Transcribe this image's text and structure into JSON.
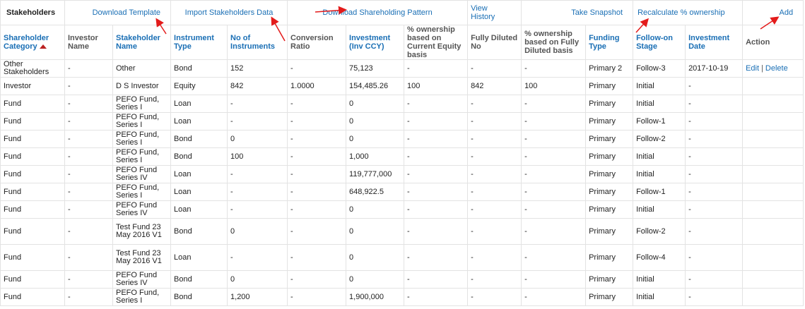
{
  "toolbar": {
    "title": "Stakeholders",
    "download_template": "Download Template",
    "import_data": "Import Stakeholders Data",
    "download_pattern": "Download Shareholding Pattern",
    "view_history": "View History",
    "take_snapshot": "Take Snapshot",
    "recalculate": "Recalculate % ownership",
    "add": "Add"
  },
  "columns": [
    "Shareholder Category",
    "Investor Name",
    "Stakeholder Name",
    "Instrument Type",
    "No of Instruments",
    "Conversion Ratio",
    "Investment (Inv CCY)",
    "% ownership based on Current Equity basis",
    "Fully Diluted No",
    "% ownership based on Fully Diluted basis",
    "Funding Type",
    "Follow-on Stage",
    "Investment Date",
    "Action"
  ],
  "actions": {
    "edit": "Edit",
    "separator": "|",
    "delete": "Delete"
  },
  "rows": [
    [
      "Other Stakeholders",
      "-",
      "Other",
      "Bond",
      "152",
      "-",
      "75,123",
      "-",
      "-",
      "-",
      "Primary 2",
      "Follow-3",
      "2017-10-19"
    ],
    [
      "Investor",
      "-",
      "D S Investor",
      "Equity",
      "842",
      "1.0000",
      "154,485.26",
      "100",
      "842",
      "100",
      "Primary",
      "Initial",
      "-"
    ],
    [
      "Fund",
      "-",
      "PEFO Fund, Series I",
      "Loan",
      "-",
      "-",
      "0",
      "-",
      "-",
      "-",
      "Primary",
      "Initial",
      "-"
    ],
    [
      "Fund",
      "-",
      "PEFO Fund, Series I",
      "Loan",
      "-",
      "-",
      "0",
      "-",
      "-",
      "-",
      "Primary",
      "Follow-1",
      "-"
    ],
    [
      "Fund",
      "-",
      "PEFO Fund, Series I",
      "Bond",
      "0",
      "-",
      "0",
      "-",
      "-",
      "-",
      "Primary",
      "Follow-2",
      "-"
    ],
    [
      "Fund",
      "-",
      "PEFO Fund, Series I",
      "Bond",
      "100",
      "-",
      "1,000",
      "-",
      "-",
      "-",
      "Primary",
      "Initial",
      "-"
    ],
    [
      "Fund",
      "-",
      "PEFO Fund Series IV",
      "Loan",
      "-",
      "-",
      "119,777,000",
      "-",
      "-",
      "-",
      "Primary",
      "Initial",
      "-"
    ],
    [
      "Fund",
      "-",
      "PEFO Fund, Series I",
      "Loan",
      "-",
      "-",
      "648,922.5",
      "-",
      "-",
      "-",
      "Primary",
      "Follow-1",
      "-"
    ],
    [
      "Fund",
      "-",
      "PEFO Fund Series IV",
      "Loan",
      "-",
      "-",
      "0",
      "-",
      "-",
      "-",
      "Primary",
      "Initial",
      "-"
    ],
    [
      "Fund",
      "-",
      "Test Fund 23 May 2016 V1",
      "Bond",
      "0",
      "-",
      "0",
      "-",
      "-",
      "-",
      "Primary",
      "Follow-2",
      "-"
    ],
    [
      "Fund",
      "-",
      "Test Fund 23 May 2016 V1",
      "Loan",
      "-",
      "-",
      "0",
      "-",
      "-",
      "-",
      "Primary",
      "Follow-4",
      "-"
    ],
    [
      "Fund",
      "-",
      "PEFO Fund Series IV",
      "Bond",
      "0",
      "-",
      "0",
      "-",
      "-",
      "-",
      "Primary",
      "Initial",
      "-"
    ],
    [
      "Fund",
      "-",
      "PEFO Fund, Series I",
      "Bond",
      "1,200",
      "-",
      "1,900,000",
      "-",
      "-",
      "-",
      "Primary",
      "Initial",
      "-"
    ]
  ]
}
